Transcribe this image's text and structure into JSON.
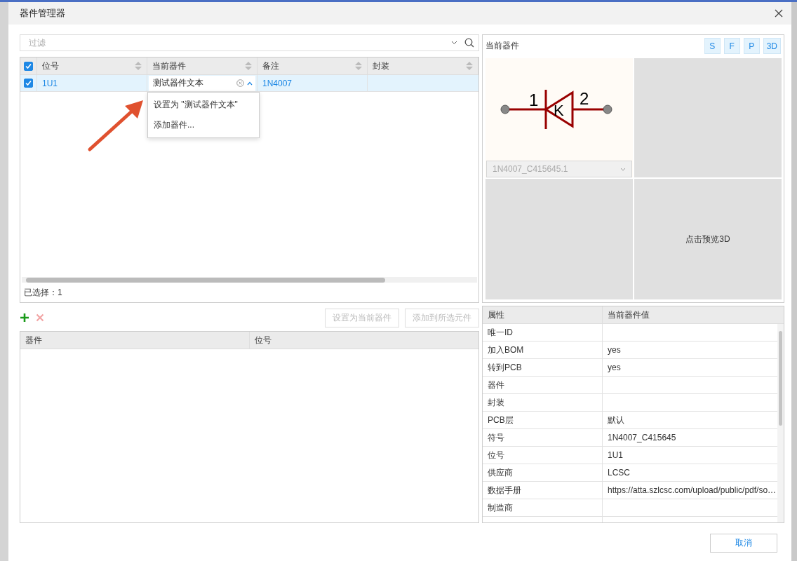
{
  "window": {
    "title": "器件管理器"
  },
  "filter": {
    "placeholder": "过滤"
  },
  "parts_table": {
    "header_checked": true,
    "columns": [
      "位号",
      "当前器件",
      "备注",
      "封装"
    ],
    "rows": [
      {
        "selected": true,
        "checked": true,
        "designator": "1U1",
        "editor_value": "测试器件文本",
        "note": "1N4007"
      }
    ]
  },
  "suggestions": [
    {
      "label": "设置为 \"测试器件文本\""
    },
    {
      "label": "添加器件..."
    }
  ],
  "selection_status": "已选择：1",
  "actions": [
    {
      "label": "设置为当前器件",
      "disabled": true
    },
    {
      "label": "添加到所选元件",
      "disabled": true
    }
  ],
  "assigned_table": {
    "columns": [
      "器件",
      "位号"
    ]
  },
  "preview": {
    "title": "当前器件",
    "view_buttons": [
      {
        "label": "S"
      },
      {
        "label": "F"
      },
      {
        "label": "P"
      },
      {
        "label": "3D"
      }
    ],
    "symbol": {
      "pin_numbers": [
        "1",
        "2"
      ],
      "mark": "K"
    },
    "variant_select": {
      "value": "1N4007_C415645.1",
      "disabled": true
    },
    "hint_3d": "点击预览3D"
  },
  "properties": {
    "columns": [
      "属性",
      "当前器件值"
    ],
    "rows": [
      {
        "name": "唯一ID"
      },
      {
        "name": "加入BOM",
        "value": "yes"
      },
      {
        "name": "转到PCB",
        "value": "yes"
      },
      {
        "name": "器件"
      },
      {
        "name": "封装"
      },
      {
        "name": "PCB层",
        "value": "默认"
      },
      {
        "name": "符号",
        "value": "1N4007_C415645"
      },
      {
        "name": "位号",
        "value": "1U1"
      },
      {
        "name": "供应商",
        "value": "LCSC"
      },
      {
        "name": "数据手册",
        "value": "https://atta.szlcsc.com/upload/public/pdf/so…"
      },
      {
        "name": "制造商"
      }
    ]
  },
  "buttons": [
    {
      "label": "取消"
    }
  ]
}
